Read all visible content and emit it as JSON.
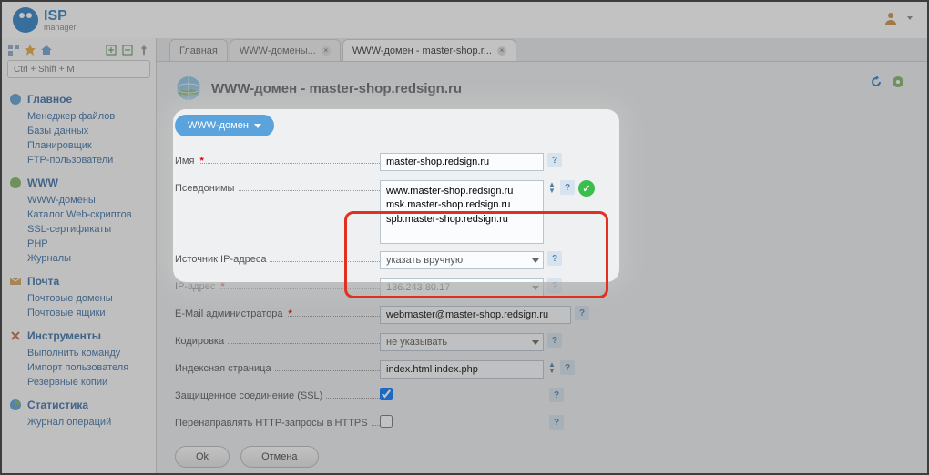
{
  "logo": {
    "main": "ISP",
    "sub": "manager"
  },
  "sidebar": {
    "search_placeholder": "Ctrl + Shift + M",
    "sections": [
      {
        "icon": "globe-blue",
        "title": "Главное",
        "items": [
          "Менеджер файлов",
          "Базы данных",
          "Планировщик",
          "FTP-пользователи"
        ]
      },
      {
        "icon": "globe-green",
        "title": "WWW",
        "items": [
          "WWW-домены",
          "Каталог Web-скриптов",
          "SSL-сертификаты",
          "PHP",
          "Журналы"
        ]
      },
      {
        "icon": "mail",
        "title": "Почта",
        "items": [
          "Почтовые домены",
          "Почтовые ящики"
        ]
      },
      {
        "icon": "tools",
        "title": "Инструменты",
        "items": [
          "Выполнить команду",
          "Импорт пользователя",
          "Резервные копии"
        ]
      },
      {
        "icon": "stats",
        "title": "Статистика",
        "items": [
          "Журнал операций"
        ]
      }
    ]
  },
  "tabs": [
    {
      "label": "Главная",
      "closable": false,
      "active": false
    },
    {
      "label": "WWW-домены...",
      "closable": true,
      "active": false
    },
    {
      "label": "WWW-домен - master-shop.r...",
      "closable": true,
      "active": true
    }
  ],
  "page": {
    "title": "WWW-домен - master-shop.redsign.ru"
  },
  "subtab": {
    "label": "WWW-домен"
  },
  "form": {
    "name": {
      "label": "Имя",
      "value": "master-shop.redsign.ru",
      "required": true
    },
    "aliases": {
      "label": "Псевдонимы",
      "value": "www.master-shop.redsign.ru\nmsk.master-shop.redsign.ru\nspb.master-shop.redsign.ru"
    },
    "ip_source": {
      "label": "Источник IP-адреса",
      "value": "указать вручную"
    },
    "ip": {
      "label": "IP-адрес",
      "value": "136.243.80.17",
      "required": true
    },
    "email": {
      "label": "E-Mail администратора",
      "value": "webmaster@master-shop.redsign.ru",
      "required": true
    },
    "encoding": {
      "label": "Кодировка",
      "value": "не указывать"
    },
    "index": {
      "label": "Индексная страница",
      "value": "index.html index.php"
    },
    "ssl": {
      "label": "Защищенное соединение (SSL)",
      "checked": true
    },
    "https_redirect": {
      "label": "Перенаправлять HTTP-запросы в HTTPS",
      "checked": false
    }
  },
  "buttons": {
    "ok": "Ok",
    "cancel": "Отмена"
  }
}
